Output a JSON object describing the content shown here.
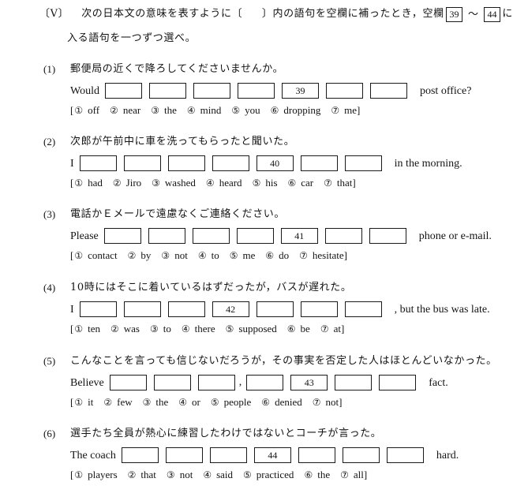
{
  "header": {
    "section_label": "〔V〕",
    "line1_a": "次の日本文の意味を表すように〔",
    "line1_b": "〕内の語句を空欄に補ったとき，空欄",
    "blank_from": "39",
    "tilde": "～",
    "blank_to": "44",
    "line1_c": "に",
    "line2": "入る語句を一つずつ選べ。"
  },
  "questions": [
    {
      "number": "(1)",
      "japanese": "郵便局の近くで降ろしてくださいませんか。",
      "lead": "Would",
      "tail": "post office?",
      "blanks": [
        "",
        "",
        "",
        "",
        "39",
        "",
        ""
      ],
      "comma_after": null,
      "bracket_open": "[",
      "bracket_close": "]",
      "options": [
        {
          "mark": "①",
          "word": "off"
        },
        {
          "mark": "②",
          "word": "near"
        },
        {
          "mark": "③",
          "word": "the"
        },
        {
          "mark": "④",
          "word": "mind"
        },
        {
          "mark": "⑤",
          "word": "you"
        },
        {
          "mark": "⑥",
          "word": "dropping"
        },
        {
          "mark": "⑦",
          "word": "me"
        }
      ]
    },
    {
      "number": "(2)",
      "japanese": "次郎が午前中に車を洗ってもらったと聞いた。",
      "lead": "I",
      "tail": "in the morning.",
      "blanks": [
        "",
        "",
        "",
        "",
        "40",
        "",
        ""
      ],
      "comma_after": null,
      "bracket_open": "[",
      "bracket_close": "]",
      "options": [
        {
          "mark": "①",
          "word": "had"
        },
        {
          "mark": "②",
          "word": "Jiro"
        },
        {
          "mark": "③",
          "word": "washed"
        },
        {
          "mark": "④",
          "word": "heard"
        },
        {
          "mark": "⑤",
          "word": "his"
        },
        {
          "mark": "⑥",
          "word": "car"
        },
        {
          "mark": "⑦",
          "word": "that"
        }
      ]
    },
    {
      "number": "(3)",
      "japanese": "電話かＥメールで遠慮なくご連絡ください。",
      "lead": "Please",
      "tail": "phone or e-mail.",
      "blanks": [
        "",
        "",
        "",
        "",
        "41",
        "",
        ""
      ],
      "comma_after": null,
      "bracket_open": "[",
      "bracket_close": "]",
      "options": [
        {
          "mark": "①",
          "word": "contact"
        },
        {
          "mark": "②",
          "word": "by"
        },
        {
          "mark": "③",
          "word": "not"
        },
        {
          "mark": "④",
          "word": "to"
        },
        {
          "mark": "⑤",
          "word": "me"
        },
        {
          "mark": "⑥",
          "word": "do"
        },
        {
          "mark": "⑦",
          "word": "hesitate"
        }
      ]
    },
    {
      "number": "(4)",
      "japanese": "10時にはそこに着いているはずだったが，バスが遅れた。",
      "lead": "I",
      "tail": ", but the bus was late.",
      "blanks": [
        "",
        "",
        "",
        "42",
        "",
        "",
        ""
      ],
      "comma_after": null,
      "bracket_open": "[",
      "bracket_close": "]",
      "options": [
        {
          "mark": "①",
          "word": "ten"
        },
        {
          "mark": "②",
          "word": "was"
        },
        {
          "mark": "③",
          "word": "to"
        },
        {
          "mark": "④",
          "word": "there"
        },
        {
          "mark": "⑤",
          "word": "supposed"
        },
        {
          "mark": "⑥",
          "word": "be"
        },
        {
          "mark": "⑦",
          "word": "at"
        }
      ]
    },
    {
      "number": "(5)",
      "japanese": "こんなことを言っても信じないだろうが，その事実を否定した人はほとんどいなかった。",
      "lead": "Believe",
      "tail": "fact.",
      "blanks": [
        "",
        "",
        "",
        "",
        "43",
        "",
        ""
      ],
      "comma_after": 3,
      "comma_char": ",",
      "bracket_open": "[",
      "bracket_close": "]",
      "options": [
        {
          "mark": "①",
          "word": "it"
        },
        {
          "mark": "②",
          "word": "few"
        },
        {
          "mark": "③",
          "word": "the"
        },
        {
          "mark": "④",
          "word": "or"
        },
        {
          "mark": "⑤",
          "word": "people"
        },
        {
          "mark": "⑥",
          "word": "denied"
        },
        {
          "mark": "⑦",
          "word": "not"
        }
      ]
    },
    {
      "number": "(6)",
      "japanese": "選手たち全員が熱心に練習したわけではないとコーチが言った。",
      "lead": "The coach",
      "tail": "hard.",
      "blanks": [
        "",
        "",
        "",
        "44",
        "",
        "",
        ""
      ],
      "comma_after": null,
      "bracket_open": "[",
      "bracket_close": "]",
      "options": [
        {
          "mark": "①",
          "word": "players"
        },
        {
          "mark": "②",
          "word": "that"
        },
        {
          "mark": "③",
          "word": "not"
        },
        {
          "mark": "④",
          "word": "said"
        },
        {
          "mark": "⑤",
          "word": "practiced"
        },
        {
          "mark": "⑥",
          "word": "the"
        },
        {
          "mark": "⑦",
          "word": "all"
        }
      ]
    }
  ]
}
